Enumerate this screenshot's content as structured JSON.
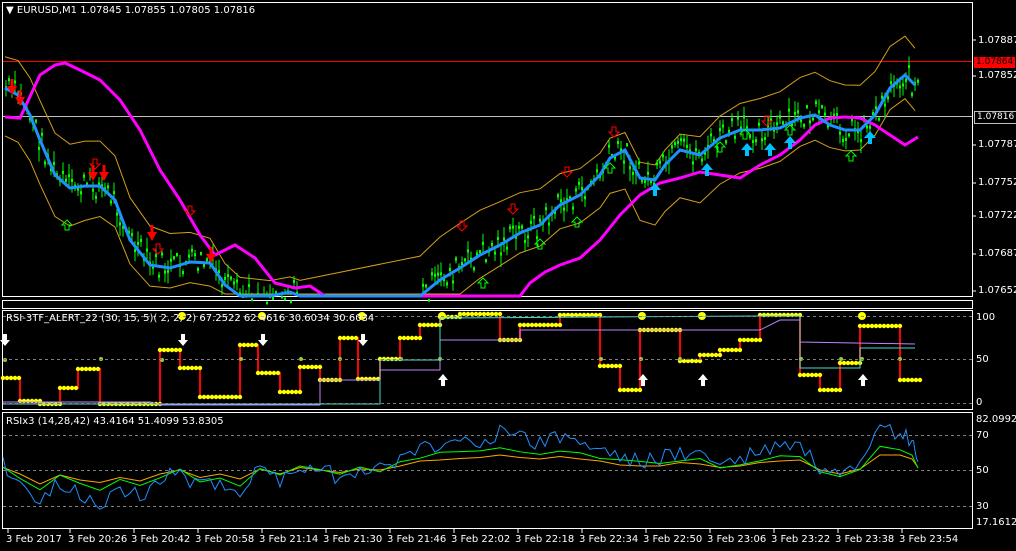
{
  "main": {
    "title": "EURUSD,M1",
    "ohlc": "1.07845 1.07855 1.07805 1.07816",
    "price_labels": [
      "1.07887",
      "1.07852",
      "1.07787",
      "1.07752",
      "1.07722",
      "1.07687",
      "1.07652"
    ],
    "current_price_tag": "1.07816",
    "alert_price_tag": "1.07864",
    "colors": {
      "frame": "#ffffff",
      "candles": "#00ff00",
      "band": "#d4a017",
      "fast_ma": "#1e90ff",
      "slow_ma": "#ff00ff",
      "arrow_up": "#00ff00",
      "arrow_down": "#ff0000",
      "alert_line": "#ff0000",
      "tag_bg": "#ff0000"
    }
  },
  "panel_rsi_tf": {
    "title": "RSI-3TF_ALERT_22 (30, 15, 5)( 2, 2, 2)",
    "values": "67.2522 62.4616 30.6034 30.6034",
    "scale_labels": [
      "100",
      "50",
      "0"
    ],
    "colors": {
      "dots": "#ffff00",
      "step": "#ff0000",
      "line1": "#c084fc",
      "line2": "#40e0d0",
      "arrow": "#ffffff"
    }
  },
  "panel_rsix3": {
    "title": "RSIx3 (14,28,42)",
    "values": "43.4164 51.4099 53.8305",
    "scale_labels": [
      "82.0992",
      "70",
      "50",
      "30",
      "17.1612"
    ],
    "colors": {
      "rsi14": "#1e90ff",
      "rsi28": "#00ff00",
      "rsi42": "#ffa500"
    }
  },
  "time_axis": [
    "3 Feb 2017",
    "3 Feb 20:26",
    "3 Feb 20:42",
    "3 Feb 20:58",
    "3 Feb 21:14",
    "3 Feb 21:30",
    "3 Feb 21:46",
    "3 Feb 22:02",
    "3 Feb 22:18",
    "3 Feb 22:34",
    "3 Feb 22:50",
    "3 Feb 23:06",
    "3 Feb 23:22",
    "3 Feb 23:38",
    "3 Feb 23:54"
  ]
}
